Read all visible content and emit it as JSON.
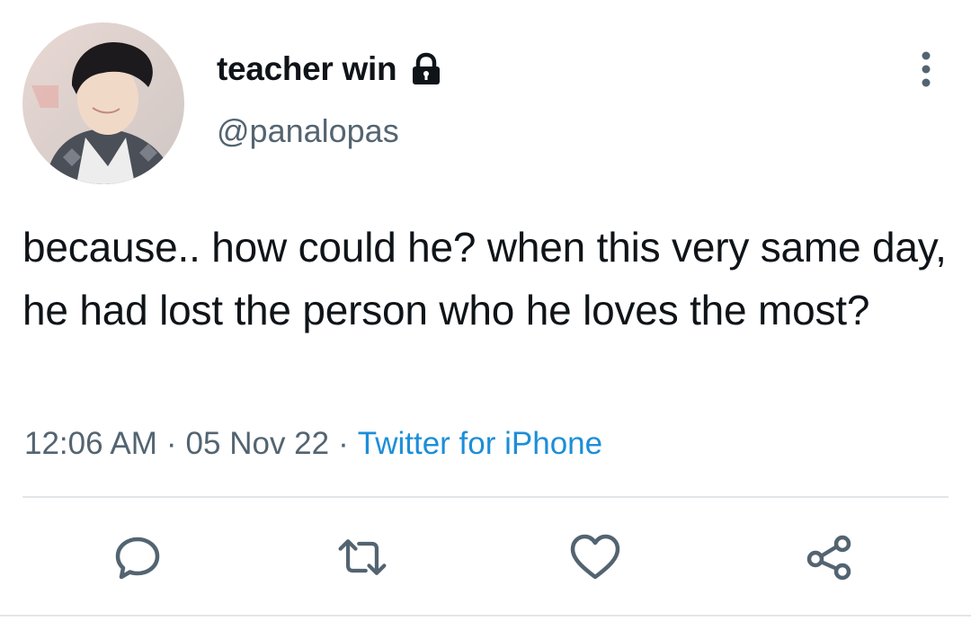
{
  "profile": {
    "display_name": "teacher win",
    "handle": "@panalopas",
    "protected_icon": "lock-icon",
    "avatar": "profile-photo"
  },
  "tweet": {
    "text": "because.. how could he? when this very same day, he had lost the person who he loves the most?",
    "time": "12:06 AM",
    "separator": "·",
    "date": "05 Nov 22",
    "source": "Twitter for iPhone"
  },
  "actions": {
    "reply_icon": "reply-icon",
    "retweet_icon": "retweet-icon",
    "like_icon": "heart-icon",
    "share_icon": "share-icon"
  },
  "colors": {
    "text": "#0f1419",
    "secondary": "#536471",
    "link": "#1d8ed8",
    "icon": "#536471",
    "divider": "#e3e6e8"
  }
}
